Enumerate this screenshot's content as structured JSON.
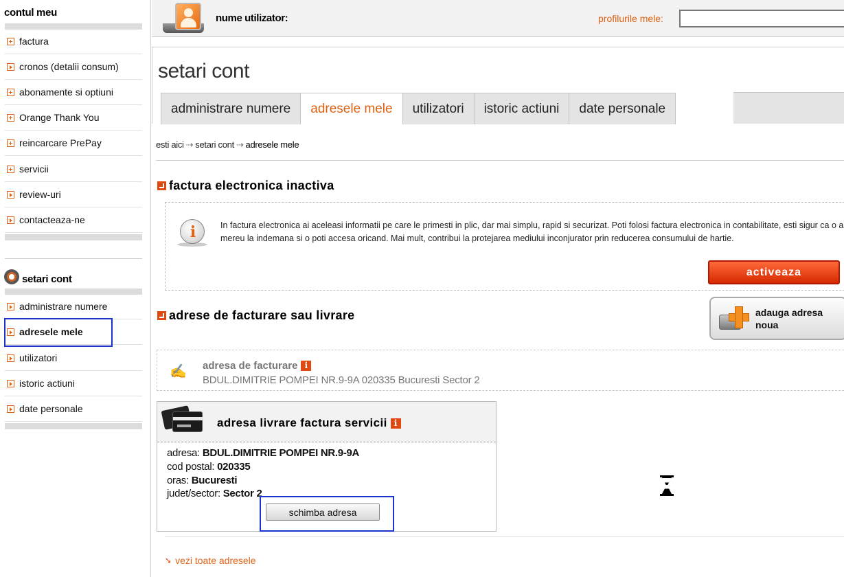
{
  "sidebar": {
    "section1_title": "contul meu",
    "section1_items": [
      {
        "label": "factura",
        "marker": "plus"
      },
      {
        "label": "cronos (detalii consum)",
        "marker": "arrow"
      },
      {
        "label": "abonamente si optiuni",
        "marker": "plus"
      },
      {
        "label": "Orange Thank You",
        "marker": "plus"
      },
      {
        "label": "reincarcare PrePay",
        "marker": "plus"
      },
      {
        "label": "servicii",
        "marker": "plus"
      },
      {
        "label": "review-uri",
        "marker": "arrow"
      },
      {
        "label": "contacteaza-ne",
        "marker": "arrow"
      }
    ],
    "section2_title": "setari cont",
    "section2_items": [
      {
        "label": "administrare numere",
        "marker": "arrow"
      },
      {
        "label": "adresele mele",
        "marker": "arrow",
        "active": true
      },
      {
        "label": "utilizatori",
        "marker": "arrow"
      },
      {
        "label": "istoric actiuni",
        "marker": "arrow"
      },
      {
        "label": "date personale",
        "marker": "arrow"
      }
    ]
  },
  "header": {
    "user_label": "nume utilizator:",
    "user_value": "",
    "profiles_label": "profilurile mele:",
    "profiles_value": ""
  },
  "page": {
    "title": "setari cont",
    "tabs": [
      {
        "label": "administrare numere",
        "active": false
      },
      {
        "label": "adresele mele",
        "active": true
      },
      {
        "label": "utilizatori",
        "active": false
      },
      {
        "label": "istoric actiuni",
        "active": false
      },
      {
        "label": "date personale",
        "active": false
      }
    ],
    "breadcrumb": [
      "esti aici",
      "setari cont",
      "adresele mele"
    ],
    "breadcrumb_separator": "⇢"
  },
  "efactura": {
    "heading": "factura electronica inactiva",
    "info_text": "In factura electronica ai aceleasi informatii pe care le primesti in plic, dar mai simplu, rapid si securizat. Poti folosi factura electronica in contabilitate, esti sigur ca o ai mereu la indemana si o poti accesa oricand. Mai mult, contribui la protejarea mediului inconjurator prin reducerea consumului de hartie.",
    "activate_label": "activeaza"
  },
  "addresses": {
    "heading": "adrese de facturare sau livrare",
    "add_button_label": "adauga adresa noua",
    "billing_title": "adresa de facturare",
    "billing_value": "BDUL.DIMITRIE POMPEI NR.9-9A 020335 Bucuresti Sector 2",
    "delivery_title": "adresa livrare factura servicii",
    "fields": [
      {
        "label": "adresa:",
        "value": "BDUL.DIMITRIE POMPEI NR.9-9A"
      },
      {
        "label": "cod postal:",
        "value": "020335"
      },
      {
        "label": "oras:",
        "value": "Bucuresti"
      },
      {
        "label": "judet/sector:",
        "value": "Sector 2"
      }
    ],
    "change_button_label": "schimba adresa",
    "all_addresses_link": "vezi toate adresele"
  },
  "colors": {
    "accent": "#e06010",
    "button_red": "#d62a00",
    "highlight_box": "#1a33cc"
  }
}
